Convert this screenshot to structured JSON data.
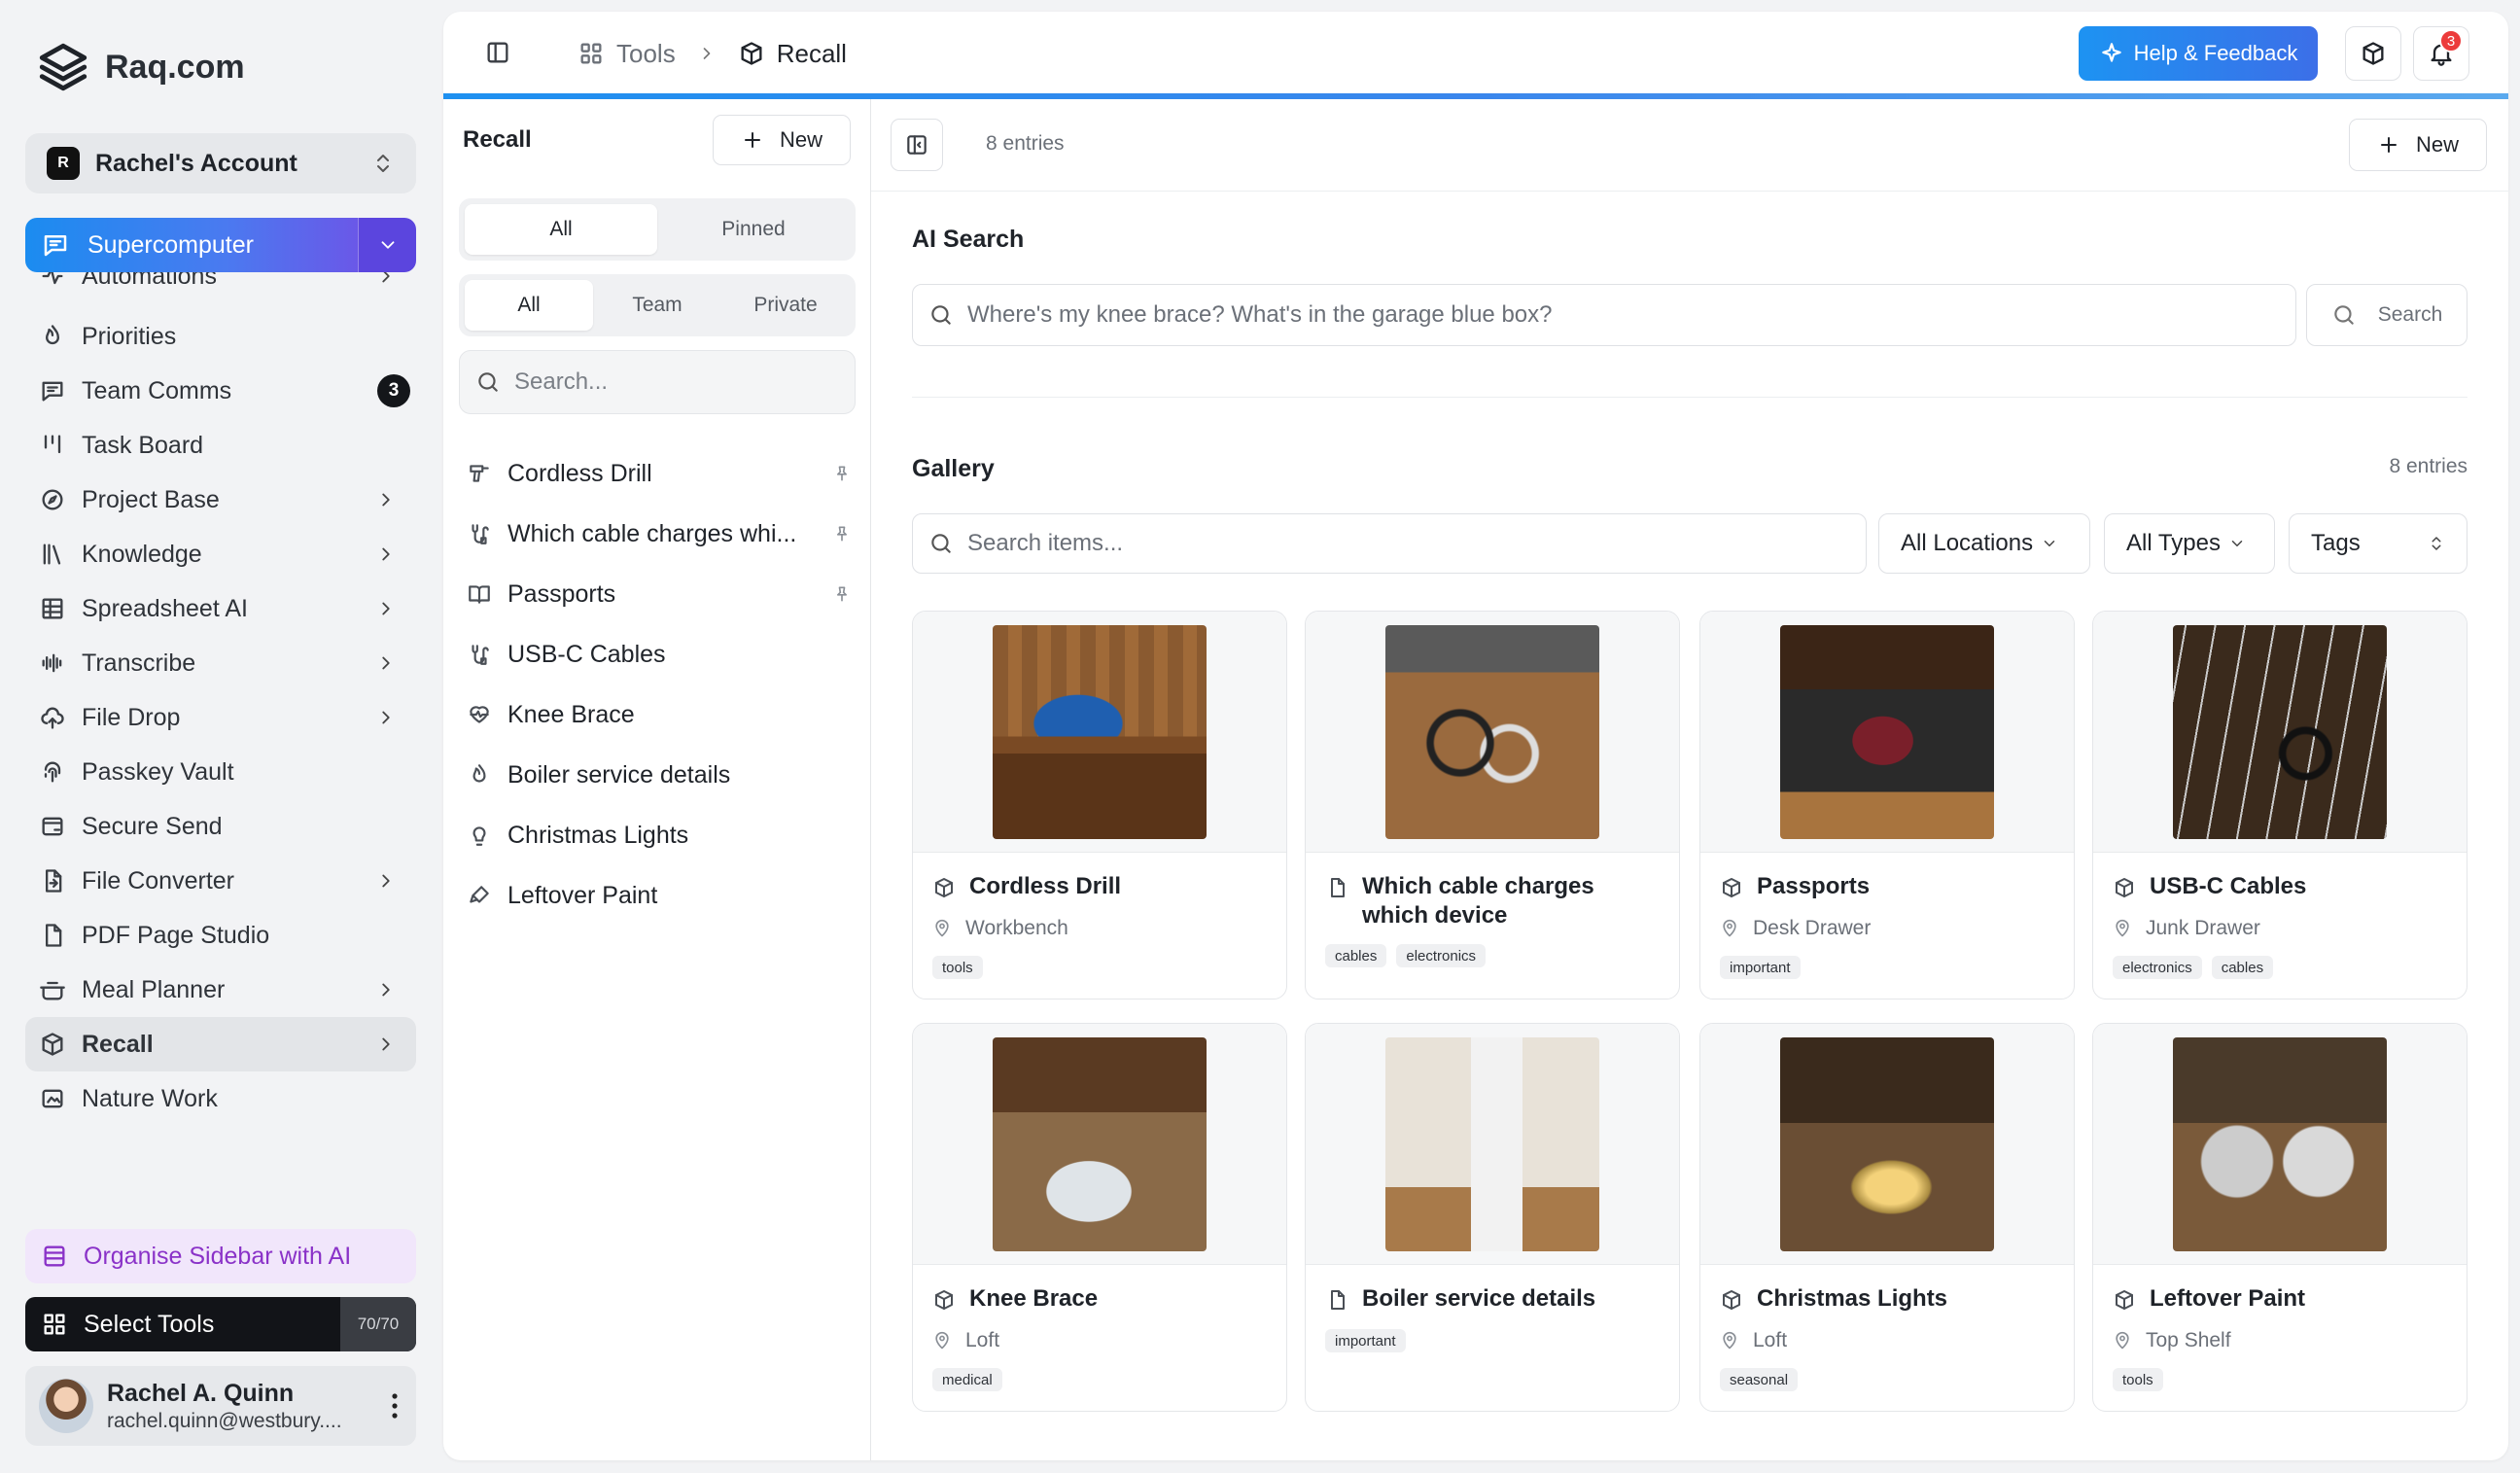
{
  "brand": {
    "name": "Raq.com"
  },
  "account": {
    "initial": "R",
    "name": "Rachel's Account"
  },
  "supercomputer": {
    "label": "Supercomputer"
  },
  "sidebar": {
    "items": [
      {
        "label": "Automations",
        "icon": "automation-icon",
        "chevron": true
      },
      {
        "label": "Priorities",
        "icon": "flame-icon",
        "chevron": false
      },
      {
        "label": "Team Comms",
        "icon": "chat-icon",
        "chevron": false,
        "count": "3"
      },
      {
        "label": "Task Board",
        "icon": "kanban-icon",
        "chevron": false
      },
      {
        "label": "Project Base",
        "icon": "compass-icon",
        "chevron": true
      },
      {
        "label": "Knowledge",
        "icon": "library-icon",
        "chevron": true
      },
      {
        "label": "Spreadsheet AI",
        "icon": "grid-icon",
        "chevron": true
      },
      {
        "label": "Transcribe",
        "icon": "waveform-icon",
        "chevron": true
      },
      {
        "label": "File Drop",
        "icon": "cloud-upload-icon",
        "chevron": true
      },
      {
        "label": "Passkey Vault",
        "icon": "fingerprint-icon",
        "chevron": false
      },
      {
        "label": "Secure Send",
        "icon": "lock-send-icon",
        "chevron": false
      },
      {
        "label": "File Converter",
        "icon": "file-convert-icon",
        "chevron": true
      },
      {
        "label": "PDF Page Studio",
        "icon": "pdf-icon",
        "chevron": false
      },
      {
        "label": "Meal Planner",
        "icon": "cooking-pot-icon",
        "chevron": true
      },
      {
        "label": "Recall",
        "icon": "box-icon",
        "chevron": true,
        "active": true
      },
      {
        "label": "Nature Work",
        "icon": "nature-icon",
        "chevron": false
      }
    ],
    "organise_label": "Organise Sidebar with AI",
    "select_tools_label": "Select Tools",
    "tools_quota": "70/70"
  },
  "user": {
    "name": "Rachel A. Quinn",
    "email": "rachel.quinn@westbury...."
  },
  "topbar": {
    "breadcrumb_tools": "Tools",
    "breadcrumb_current": "Recall",
    "help_label": "Help & Feedback",
    "notification_count": "3"
  },
  "list_panel": {
    "title": "Recall",
    "new_label": "New",
    "scope_tabs": [
      "All",
      "Pinned"
    ],
    "visibility_tabs": [
      "All",
      "Team",
      "Private"
    ],
    "search_placeholder": "Search...",
    "items": [
      {
        "label": "Cordless Drill",
        "icon": "drill-icon",
        "pinned": true
      },
      {
        "label": "Which cable charges whi...",
        "icon": "cable-icon",
        "pinned": true
      },
      {
        "label": "Passports",
        "icon": "book-open-icon",
        "pinned": true
      },
      {
        "label": "USB-C Cables",
        "icon": "cable-icon",
        "pinned": false
      },
      {
        "label": "Knee Brace",
        "icon": "heart-pulse-icon",
        "pinned": false
      },
      {
        "label": "Boiler service details",
        "icon": "flame-icon",
        "pinned": false
      },
      {
        "label": "Christmas Lights",
        "icon": "lightbulb-icon",
        "pinned": false
      },
      {
        "label": "Leftover Paint",
        "icon": "paint-brush-icon",
        "pinned": false
      }
    ]
  },
  "content": {
    "entries_label": "8 entries",
    "new_label": "New",
    "ai_search": {
      "title": "AI Search",
      "placeholder": "Where's my knee brace? What's in the garage blue box?",
      "button_label": "Search"
    },
    "gallery": {
      "title": "Gallery",
      "count_label": "8 entries",
      "search_placeholder": "Search items...",
      "filters": {
        "locations": "All Locations",
        "types": "All Types",
        "tags": "Tags"
      },
      "cards": [
        {
          "title": "Cordless Drill",
          "type_icon": "box-icon",
          "location": "Workbench",
          "tags": [
            "tools"
          ],
          "thumb": "t-drill"
        },
        {
          "title": "Which cable charges which device",
          "type_icon": "document-icon",
          "location": "",
          "tags": [
            "cables",
            "electronics"
          ],
          "thumb": "t-cables"
        },
        {
          "title": "Passports",
          "type_icon": "box-icon",
          "location": "Desk Drawer",
          "tags": [
            "important"
          ],
          "thumb": "t-pass"
        },
        {
          "title": "USB-C Cables",
          "type_icon": "box-icon",
          "location": "Junk Drawer",
          "tags": [
            "electronics",
            "cables"
          ],
          "thumb": "t-usbc"
        },
        {
          "title": "Knee Brace",
          "type_icon": "box-icon",
          "location": "Loft",
          "tags": [
            "medical"
          ],
          "thumb": "t-knee"
        },
        {
          "title": "Boiler service details",
          "type_icon": "document-icon",
          "location": "",
          "tags": [
            "important"
          ],
          "thumb": "t-boiler"
        },
        {
          "title": "Christmas Lights",
          "type_icon": "box-icon",
          "location": "Loft",
          "tags": [
            "seasonal"
          ],
          "thumb": "t-xmas"
        },
        {
          "title": "Leftover Paint",
          "type_icon": "box-icon",
          "location": "Top Shelf",
          "tags": [
            "tools"
          ],
          "thumb": "t-paint"
        }
      ]
    }
  }
}
